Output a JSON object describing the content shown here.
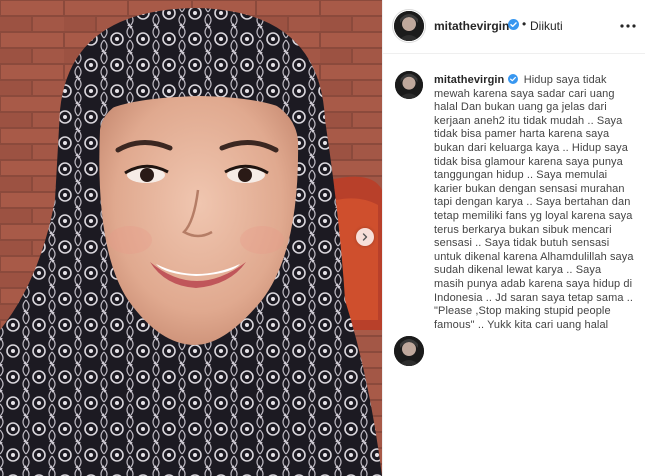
{
  "post": {
    "username": "mitathevirgin",
    "verified": true,
    "separator": "•",
    "follow_status": "Diikuti",
    "more_icon": "ellipsis-icon",
    "caption": "Hidup saya tidak mewah karena saya sadar cari uang halal Dan bukan uang ga jelas dari kerjaan aneh2 itu tidak mudah .. Saya tidak bisa pamer harta karena saya bukan dari keluarga kaya .. Hidup saya tidak bisa glamour karena saya punya tanggungan hidup .. Saya memulai karier bukan dengan sensasi murahan tapi dengan karya .. Saya bertahan dan tetap memiliki fans yg loyal karena saya terus berkarya bukan sibuk mencari sensasi .. Saya tidak butuh sensasi untuk dikenal karena Alhamdulillah saya sudah dikenal lewat karya .. Saya masih punya adab karena saya hidup di Indonesia .. Jd saran saya tetap sama .. \"Please ,Stop making stupid people famous\" .. Yukk kita cari uang halal"
  },
  "colors": {
    "verified_blue": "#3897f0",
    "text_primary": "#262626",
    "border": "#efefef"
  },
  "icons": {
    "carousel": "chevron-right-icon"
  }
}
